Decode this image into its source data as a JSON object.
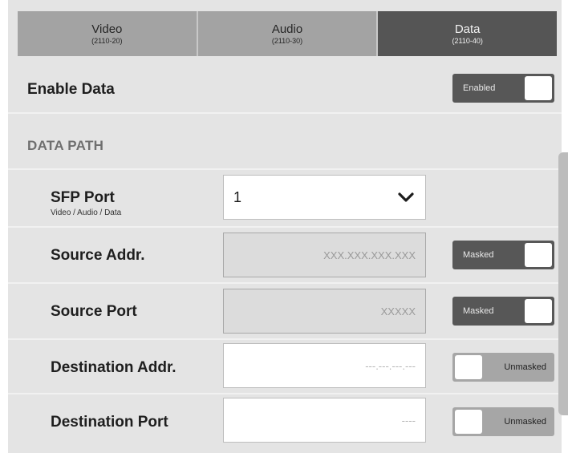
{
  "tabs": [
    {
      "label": "Video",
      "sub": "(2110-20)",
      "active": false
    },
    {
      "label": "Audio",
      "sub": "(2110-30)",
      "active": false
    },
    {
      "label": "Data",
      "sub": "(2110-40)",
      "active": true
    }
  ],
  "enable_data": {
    "label": "Enable Data",
    "toggle": {
      "text": "Enabled",
      "state": "on"
    }
  },
  "data_path": {
    "title": "DATA PATH"
  },
  "sfp_port": {
    "label": "SFP Port",
    "sub": "Video / Audio / Data",
    "value": "1",
    "icon": "chevron-down-icon"
  },
  "source_addr": {
    "label": "Source Addr.",
    "placeholder": "XXX.XXX.XXX.XXX",
    "toggle": {
      "text": "Masked",
      "state": "on"
    }
  },
  "source_port": {
    "label": "Source Port",
    "placeholder": "XXXXX",
    "toggle": {
      "text": "Masked",
      "state": "on"
    }
  },
  "dest_addr": {
    "label": "Destination Addr.",
    "placeholder": "---.---.---.---",
    "toggle": {
      "text": "Unmasked",
      "state": "off"
    }
  },
  "dest_port": {
    "label": "Destination Port",
    "placeholder": "----",
    "toggle": {
      "text": "Unmasked",
      "state": "off"
    }
  },
  "colors": {
    "active_tab": "#555555",
    "inactive_tab": "#a3a3a3",
    "panel": "#e4e4e4",
    "toggle_on": "#575757",
    "toggle_off": "#a6a6a6"
  }
}
